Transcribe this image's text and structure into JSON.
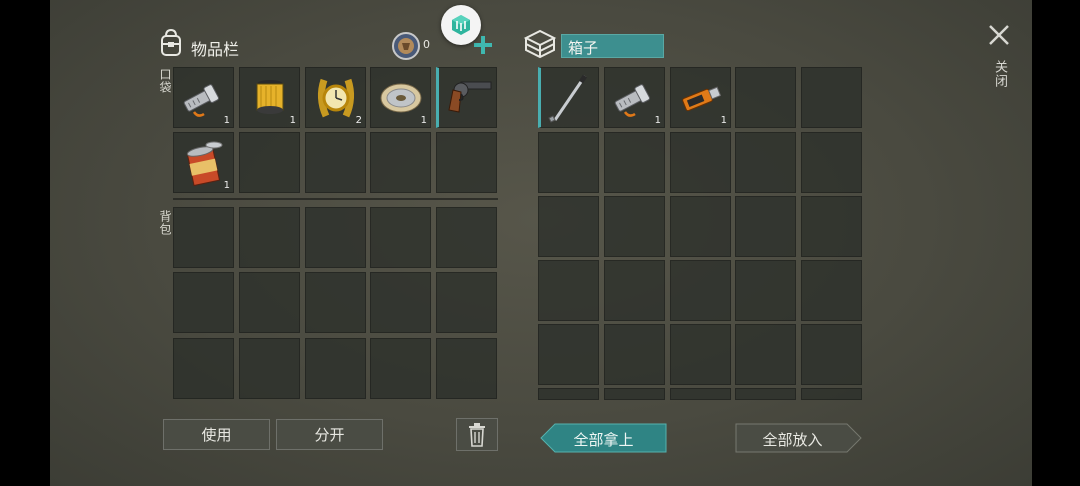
{
  "inventory": {
    "title": "物品栏",
    "coin_count": "0",
    "pocket_label": "口袋",
    "backpack_label": "背包",
    "pocket_items": [
      {
        "name": "flashlight",
        "count": "1"
      },
      {
        "name": "oil-filter",
        "count": "1"
      },
      {
        "name": "gold-watch",
        "count": "2"
      },
      {
        "name": "wire-spool",
        "count": "1"
      },
      {
        "name": "revolver",
        "count": ""
      },
      {
        "name": "tin-can",
        "count": "1"
      }
    ]
  },
  "box": {
    "title": "箱子",
    "items": [
      {
        "name": "golf-club",
        "count": ""
      },
      {
        "name": "flashlight",
        "count": "1"
      },
      {
        "name": "usb-drive",
        "count": "1"
      }
    ]
  },
  "close_label": "关闭",
  "buttons": {
    "use": "使用",
    "split": "分开",
    "take_all": "全部拿上",
    "put_all": "全部放入"
  },
  "colors": {
    "accent": "#3d8f8f",
    "selected_border": "#49aeb0",
    "bg": "#4a4a40"
  }
}
